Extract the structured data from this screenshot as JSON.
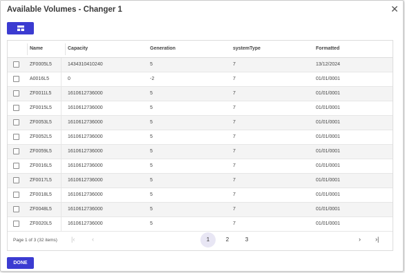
{
  "dialog": {
    "title": "Available Volumes - Changer 1",
    "close_icon": "close-icon",
    "columns_icon": "column-chooser-icon",
    "done_label": "DONE",
    "accent_color": "#3b3bd1"
  },
  "table": {
    "columns": [
      "Name",
      "Capacity",
      "Generation",
      "systemType",
      "Formatted"
    ],
    "rows": [
      {
        "name": "ZF0005L5",
        "capacity": "1434310410240",
        "generation": "5",
        "systemType": "7",
        "formatted": "13/12/2024"
      },
      {
        "name": "A0016L5",
        "capacity": "0",
        "generation": "-2",
        "systemType": "7",
        "formatted": "01/01/0001"
      },
      {
        "name": "ZF0011L5",
        "capacity": "1610612736000",
        "generation": "5",
        "systemType": "7",
        "formatted": "01/01/0001"
      },
      {
        "name": "ZF0015L5",
        "capacity": "1610612736000",
        "generation": "5",
        "systemType": "7",
        "formatted": "01/01/0001"
      },
      {
        "name": "ZF0053L5",
        "capacity": "1610612736000",
        "generation": "5",
        "systemType": "7",
        "formatted": "01/01/0001"
      },
      {
        "name": "ZF0052L5",
        "capacity": "1610612736000",
        "generation": "5",
        "systemType": "7",
        "formatted": "01/01/0001"
      },
      {
        "name": "ZF0059L5",
        "capacity": "1610612736000",
        "generation": "5",
        "systemType": "7",
        "formatted": "01/01/0001"
      },
      {
        "name": "ZF0016L5",
        "capacity": "1610612736000",
        "generation": "5",
        "systemType": "7",
        "formatted": "01/01/0001"
      },
      {
        "name": "ZF0017L5",
        "capacity": "1610612736000",
        "generation": "5",
        "systemType": "7",
        "formatted": "01/01/0001"
      },
      {
        "name": "ZF0018L5",
        "capacity": "1610612736000",
        "generation": "5",
        "systemType": "7",
        "formatted": "01/01/0001"
      },
      {
        "name": "ZF0048L5",
        "capacity": "1610612736000",
        "generation": "5",
        "systemType": "7",
        "formatted": "01/01/0001"
      },
      {
        "name": "ZF0020L5",
        "capacity": "1610612736000",
        "generation": "5",
        "systemType": "7",
        "formatted": "01/01/0001"
      }
    ]
  },
  "pager": {
    "info": "Page 1 of 3 (32 items)",
    "pages": [
      "1",
      "2",
      "3"
    ],
    "current": "1",
    "first_label": "|‹",
    "prev_label": "‹",
    "next_label": "›",
    "last_label": "›|"
  }
}
